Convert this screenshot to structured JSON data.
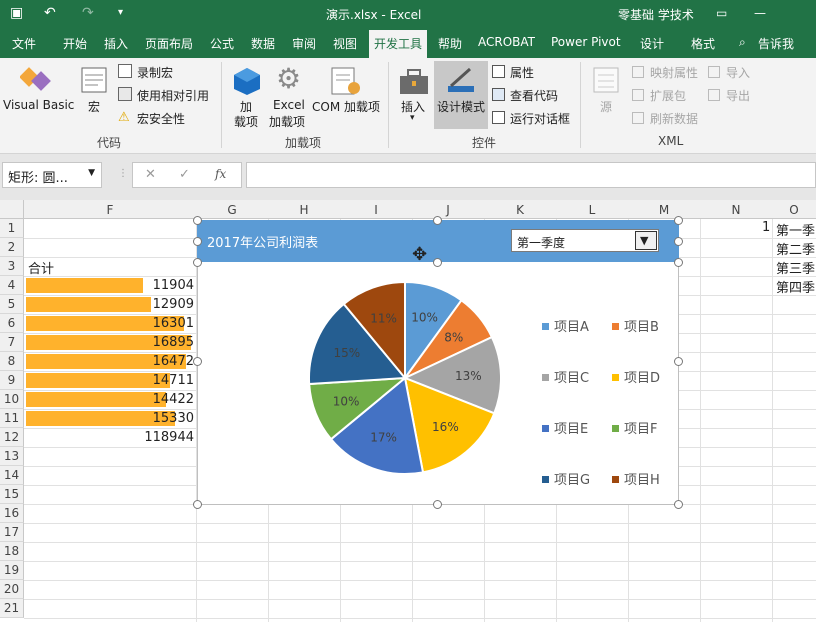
{
  "window": {
    "title": "演示.xlsx - Excel",
    "user": "零基础 学技术",
    "quick_undo": "↶",
    "quick_redo": "↷"
  },
  "tabs": [
    "文件",
    "开始",
    "插入",
    "页面布局",
    "公式",
    "数据",
    "审阅",
    "视图",
    "开发工具",
    "帮助",
    "ACROBAT",
    "Power Pivot",
    "设计",
    "格式"
  ],
  "active_tab": "开发工具",
  "tellme": "告诉我",
  "ribbon": {
    "code": {
      "visual_basic": "Visual Basic",
      "macros": "宏",
      "record": "录制宏",
      "relative": "使用相对引用",
      "security": "宏安全性",
      "group": "代码"
    },
    "addins": {
      "addins_line1": "加",
      "addins_line2": "载项",
      "excel_line1": "Excel",
      "excel_line2": "加载项",
      "com": "COM 加载项",
      "group": "加载项"
    },
    "controls": {
      "insert": "插入",
      "design_mode": "设计模式",
      "properties": "属性",
      "view_code": "查看代码",
      "run_dialog": "运行对话框",
      "group": "控件"
    },
    "xml": {
      "source": "源",
      "map_props": "映射属性",
      "expand": "扩展包",
      "refresh": "刷新数据",
      "import": "导入",
      "export": "导出",
      "group": "XML"
    }
  },
  "formula_bar": {
    "name_box": "矩形: 圆...",
    "fx": "fx",
    "cancel": "✕",
    "enter": "✓"
  },
  "columns": [
    "F",
    "G",
    "H",
    "I",
    "J",
    "K",
    "L",
    "M",
    "N",
    "O"
  ],
  "rows": [
    "1",
    "2",
    "3",
    "4",
    "5",
    "6",
    "7",
    "8",
    "9",
    "10",
    "11",
    "12",
    "13",
    "14",
    "15",
    "16",
    "17",
    "18",
    "19",
    "20",
    "21"
  ],
  "sheet": {
    "header": "合计",
    "values": [
      "11904",
      "12909",
      "16301",
      "16895",
      "16472",
      "14711",
      "14422",
      "15330"
    ],
    "value_fraction": [
      0.71,
      0.76,
      0.96,
      1.0,
      0.97,
      0.87,
      0.85,
      0.9
    ],
    "total": "118944",
    "n1": "1",
    "quarters": [
      "第一季",
      "第二季",
      "第三季",
      "第四季"
    ]
  },
  "chart_header": {
    "title": "2017年公司利润表",
    "dropdown_value": "第一季度"
  },
  "chart_data": {
    "type": "pie",
    "title": "2017年公司利润表",
    "categories": [
      "项目A",
      "项目B",
      "项目C",
      "项目D",
      "项目E",
      "项目F",
      "项目G",
      "项目H"
    ],
    "values": [
      10,
      8,
      13,
      16,
      17,
      10,
      15,
      11
    ],
    "labels": [
      "10%",
      "8%",
      "13%",
      "16%",
      "17%",
      "10%",
      "15%",
      "11%"
    ],
    "colors": [
      "#5b9bd5",
      "#ed7d31",
      "#a5a5a5",
      "#ffc000",
      "#4472c4",
      "#70ad47",
      "#255e91",
      "#9e480e"
    ],
    "legend": "right"
  }
}
